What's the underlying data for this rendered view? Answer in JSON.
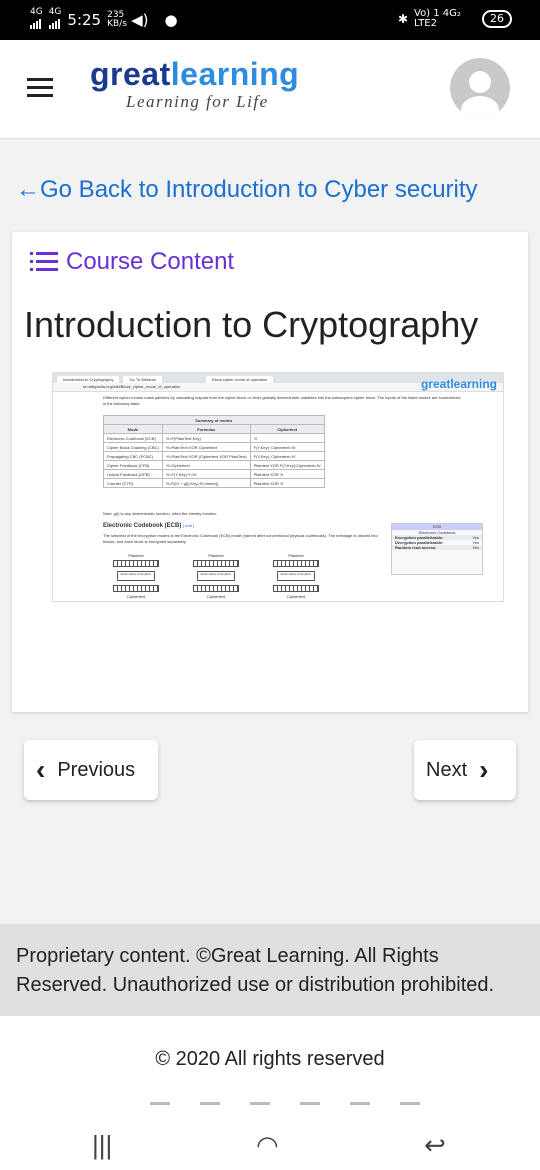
{
  "status": {
    "network_left": "4G",
    "network_left2": "4G",
    "time": "5:25",
    "speed": "235 KB/s",
    "right_label": "Vo) 1 4G₂ LTE2",
    "battery": "26"
  },
  "header": {
    "brand_part1": "great",
    "brand_part2": "learning",
    "tagline": "Learning for Life"
  },
  "back_link": "←Go Back to Introduction to Cyber security",
  "card": {
    "section_label": "Course Content",
    "title": "Introduction to Cryptography"
  },
  "embedded_screenshot": {
    "tab1": "Introduction to Cryptography",
    "tab2": "Go To Webinar",
    "tab3": "Block cipher mode of operation",
    "url": "en.wikipedia.org/wiki/Block_cipher_mode_of_operation",
    "brand": "greatlearning",
    "intro": "Different cipher modes mask patterns by cascading outputs from the cipher block or other globally deterministic variables into the subsequent cipher block. The inputs of the listed modes are summarized in the following table:",
    "table_caption": "Summary of modes",
    "table_headers": [
      "Mode",
      "Formulas",
      "Ciphertext"
    ],
    "table_rows": [
      [
        "Electronic Codebook (ECB)",
        "Yi=F(PlainText,Key)",
        "Yi"
      ],
      [
        "Cipher Block Chaining (CBC)",
        "Yi=PlainText XOR Ciphertext",
        "F(Y,Key); Ciphertext=IV"
      ],
      [
        "Propagating CBC (PCBC)",
        "Yi=PlainText XOR (Ciphertext XOR PlainText)",
        "F(Y,Key); Ciphertext=IV"
      ],
      [
        "Cipher Feedback (CFB)",
        "Yi=Ciphertext",
        "Plaintext XOR F(Y,Key);Ciphertext=IV"
      ],
      [
        "Output Feedback (OFB)",
        "Yi=F(Y,Key);Y=IV",
        "Plaintext XOR Yi"
      ],
      [
        "Counter (CTR)",
        "Yi=F(IV + g(i),Key);IV=token()",
        "Plaintext XOR Yi"
      ]
    ],
    "note": "Note: g(i) is any deterministic function, often the identity function.",
    "ecb_heading": "Electronic Codebook (ECB)",
    "ecb_edit": "[ edit ]",
    "ecb_text": "The simplest of the encryption modes is the Electronic Codebook (ECB) mode (named after conventional physical codebooks). The message is divided into blocks, and each block is encrypted separately.",
    "sidebox_head": "ECB",
    "sidebox_sub": "Electronic Codebook",
    "sidebox_rows": [
      [
        "Encryption parallelizable:",
        "Yes"
      ],
      [
        "Decryption parallelizable:",
        "Yes"
      ],
      [
        "Random read access:",
        "Yes"
      ]
    ],
    "block_top": "Plaintext",
    "block_key": "Key",
    "block_cipher": "block cipher encryption",
    "block_bottom": "Ciphertext"
  },
  "nav": {
    "previous": "Previous",
    "next": "Next"
  },
  "footer": {
    "notice": "Proprietary content. ©Great Learning. All Rights Reserved. Unauthorized use or distribution prohibited.",
    "copyright": "© 2020 All rights reserved"
  }
}
